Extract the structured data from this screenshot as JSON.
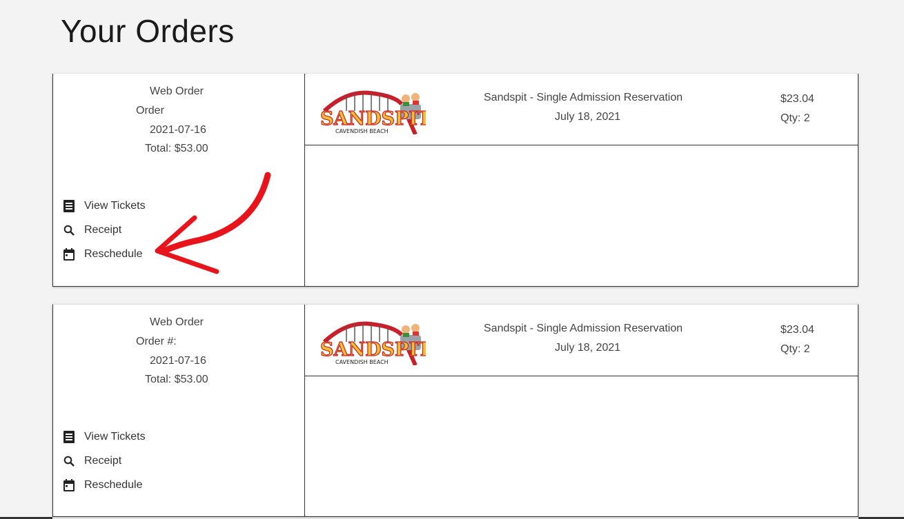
{
  "page": {
    "title": "Your Orders"
  },
  "orders": [
    {
      "source": "Web Order",
      "order_label": "Order",
      "date": "2021-07-16",
      "total": "Total: $53.00",
      "actions": [
        {
          "label": "View Tickets",
          "icon": "receipt-icon"
        },
        {
          "label": "Receipt",
          "icon": "search-icon"
        },
        {
          "label": "Reschedule",
          "icon": "calendar-icon"
        }
      ],
      "items": [
        {
          "logo_text": "SANDSPIT",
          "logo_subtext": "CAVENDISH BEACH",
          "name": "Sandspit - Single Admission Reservation",
          "date": "July 18, 2021",
          "price": "$23.04",
          "qty": "Qty: 2"
        }
      ]
    },
    {
      "source": "Web Order",
      "order_label": "Order #:",
      "date": "2021-07-16",
      "total": "Total: $53.00",
      "actions": [
        {
          "label": "View Tickets",
          "icon": "receipt-icon"
        },
        {
          "label": "Receipt",
          "icon": "search-icon"
        },
        {
          "label": "Reschedule",
          "icon": "calendar-icon"
        }
      ],
      "items": [
        {
          "logo_text": "SANDSPIT",
          "logo_subtext": "CAVENDISH BEACH",
          "name": "Sandspit - Single Admission Reservation",
          "date": "July 18, 2021",
          "price": "$23.04",
          "qty": "Qty: 2"
        }
      ]
    }
  ],
  "colors": {
    "annotation": "#e8141b",
    "logo_red": "#c8202a",
    "logo_yellow": "#f2c230"
  }
}
